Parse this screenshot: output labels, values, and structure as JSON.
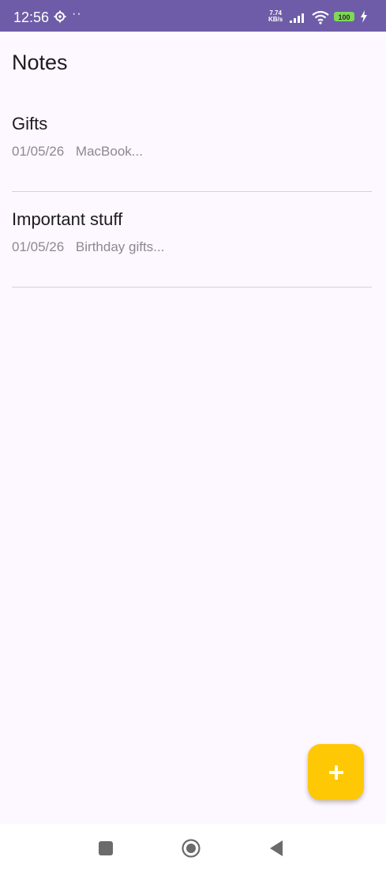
{
  "status_bar": {
    "time": "12:56",
    "dots": "··",
    "speed_value": "7.74",
    "speed_unit": "KB/s",
    "battery": "100",
    "icons": [
      "gear-icon",
      "signal-icon",
      "wifi-icon",
      "battery-icon",
      "charging-icon"
    ]
  },
  "header": {
    "title": "Notes"
  },
  "notes": [
    {
      "title": "Gifts",
      "date": "01/05/26",
      "preview": "MacBook..."
    },
    {
      "title": "Important stuff",
      "date": "01/05/26",
      "preview": "Birthday gifts..."
    }
  ],
  "fab": {
    "icon": "plus-icon",
    "color": "#ffc805"
  },
  "navigation": {
    "buttons": [
      "recents-square-icon",
      "home-circle-icon",
      "back-triangle-icon"
    ]
  },
  "colors": {
    "status_bar": "#6e5ca8",
    "background": "#fdf7ff",
    "divider": "#d6d0d9",
    "meta_text": "#8d8891",
    "battery": "#7ed957"
  }
}
